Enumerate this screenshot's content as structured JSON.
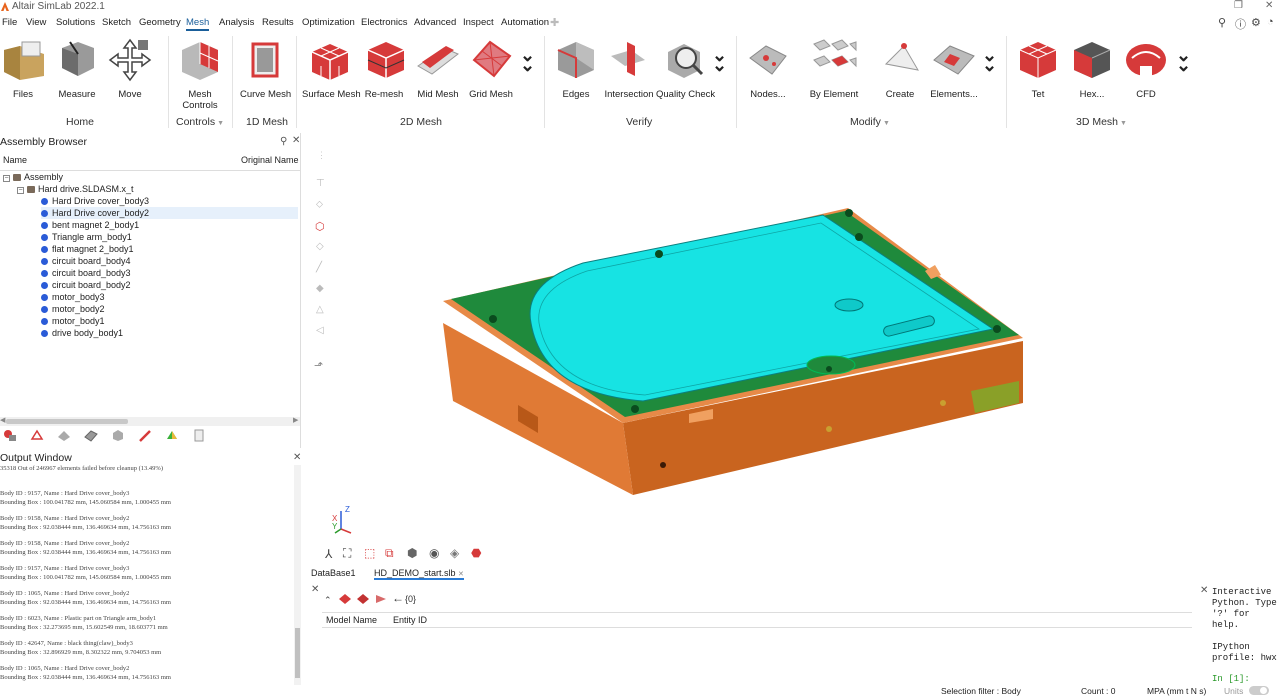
{
  "app": {
    "title": "Altair SimLab 2022.1"
  },
  "menu": {
    "items": [
      "File",
      "View",
      "Solutions",
      "Sketch",
      "Geometry",
      "Mesh",
      "Analysis",
      "Results",
      "Optimization",
      "Electronics",
      "Advanced",
      "Inspect",
      "Automation"
    ],
    "active": "Mesh"
  },
  "ribbon": {
    "tools": {
      "files": "Files",
      "measure": "Measure",
      "move": "Move",
      "mesh_controls": "Mesh Controls",
      "curve_mesh": "Curve Mesh",
      "surface_mesh": "Surface Mesh",
      "remesh": "Re-mesh",
      "mid_mesh": "Mid Mesh",
      "grid_mesh": "Grid Mesh",
      "edges": "Edges",
      "intersection": "Intersection",
      "quality_check": "Quality Check",
      "nodes": "Nodes...",
      "by_element": "By Element",
      "create": "Create",
      "elements": "Elements...",
      "tet": "Tet",
      "hex": "Hex...",
      "cfd": "CFD"
    },
    "groups": {
      "home": "Home",
      "controls": "Controls",
      "mesh_1d": "1D Mesh",
      "mesh_2d": "2D Mesh",
      "verify": "Verify",
      "modify": "Modify",
      "mesh_3d": "3D Mesh"
    }
  },
  "assembly": {
    "title": "Assembly Browser",
    "columns": {
      "name": "Name",
      "original_name": "Original Name"
    },
    "root": "Assembly",
    "file": "Hard drive.SLDASM.x_t",
    "bodies": [
      "Hard Drive cover_body3",
      "Hard Drive cover_body2",
      "bent magnet 2_body1",
      "Triangle arm_body1",
      "flat magnet 2_body1",
      "circuit board_body4",
      "circuit board_body3",
      "circuit board_body2",
      "motor_body3",
      "motor_body2",
      "motor_body1",
      "drive body_body1"
    ],
    "selected_index": 1
  },
  "output": {
    "title": "Output Window",
    "lines": [
      "35318 Out of 246967 elements failed before cleanup (13.49%)",
      "Body ID : 9157, Name : Hard Drive cover_body3",
      "Bounding Box : 100.041782 mm, 145.060584 mm, 1.000455 mm",
      "Body ID : 9158, Name : Hard Drive cover_body2",
      "Bounding Box : 92.038444 mm, 136.469634 mm, 14.756163 mm",
      "Body ID : 9158, Name : Hard Drive cover_body2",
      "Bounding Box : 92.038444 mm, 136.469634 mm, 14.756163 mm",
      "Body ID : 9157, Name : Hard Drive cover_body3",
      "Bounding Box : 100.041782 mm, 145.060584 mm, 1.000455 mm",
      "Body ID : 1065, Name : Hard Drive cover_body2",
      "Bounding Box : 92.038444 mm, 136.469634 mm, 14.756163 mm",
      "Body ID : 6023, Name : Plastic part on Triangle arm_body1",
      "Bounding Box : 32.273695 mm, 15.602549 mm, 18.603771 mm",
      "Body ID : 42647, Name : black thing(claw)_body3",
      "Bounding Box : 32.896929 mm, 8.302322 mm, 9.704053 mm",
      "Body ID : 1065, Name : Hard Drive cover_body2",
      "Bounding Box : 92.038444 mm, 136.469634 mm, 14.756163 mm"
    ]
  },
  "viewport": {
    "axis": {
      "x": "X",
      "y": "Y",
      "z": "Z"
    }
  },
  "tabs": {
    "database": "DataBase1",
    "file": "HD_DEMO_start.slb"
  },
  "entity": {
    "count_label": "{0}",
    "columns": {
      "model_name": "Model Name",
      "entity_id": "Entity ID"
    }
  },
  "python": {
    "line1": "Interactive",
    "line2": "Python. Type",
    "line3": "'?' for",
    "line4": "help.",
    "line5": "IPython",
    "line6": "profile: hwx",
    "line7": "In [1]:"
  },
  "status": {
    "selection_filter": "Selection filter : Body",
    "count": "Count : 0",
    "units": "MPA (mm t N s)",
    "units_label": "Units"
  },
  "colors": {
    "cover": "#17e3e3",
    "pcb": "#1f8a3c",
    "body": "#e07a35",
    "accent": "#1a5e9a",
    "mesh_red": "#d63a3a"
  }
}
